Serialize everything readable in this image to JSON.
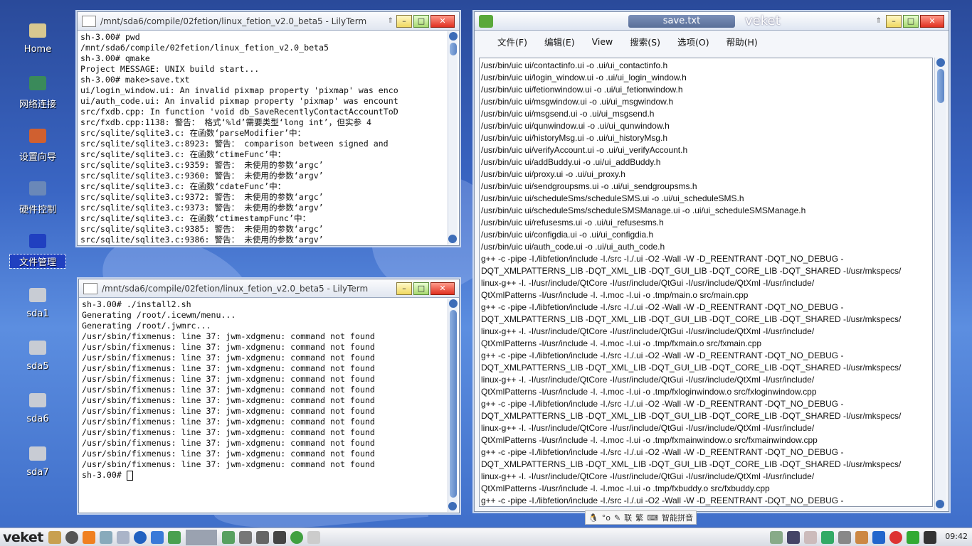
{
  "desktop": {
    "icons": [
      {
        "label": "Home",
        "icon": "folder-icon"
      },
      {
        "label": "网络连接",
        "icon": "network-icon"
      },
      {
        "label": "设置向导",
        "icon": "wizard-icon"
      },
      {
        "label": "硬件控制",
        "icon": "hardware-icon"
      },
      {
        "label": "文件管理",
        "icon": "filemanager-icon"
      },
      {
        "label": "sda1",
        "icon": "drive-icon"
      },
      {
        "label": "sda5",
        "icon": "drive-icon"
      },
      {
        "label": "sda6",
        "icon": "drive-icon"
      },
      {
        "label": "sda7",
        "icon": "drive-icon"
      }
    ]
  },
  "term1": {
    "title": "/mnt/sda6/compile/02fetion/linux_fetion_v2.0_beta5 - LilyTerm",
    "lines": [
      "sh-3.00# pwd",
      "/mnt/sda6/compile/02fetion/linux_fetion_v2.0_beta5",
      "sh-3.00# qmake",
      "Project MESSAGE: UNIX build start...",
      "sh-3.00# make>save.txt",
      "ui/login_window.ui: An invalid pixmap property 'pixmap' was enco",
      "ui/auth_code.ui: An invalid pixmap property 'pixmap' was encount",
      "src/fxdb.cpp: In function 'void db_SaveRecentlyContactAccountToD",
      "src/fxdb.cpp:1138: 警告： 格式‘%ld’需要类型‘long int’，但实参 4",
      "src/sqlite/sqlite3.c: 在函数‘parseModifier’中：",
      "src/sqlite/sqlite3.c:8923: 警告： comparison between signed and",
      "src/sqlite/sqlite3.c: 在函数‘ctimeFunc’中：",
      "src/sqlite/sqlite3.c:9359: 警告： 未使用的参数‘argc’",
      "src/sqlite/sqlite3.c:9360: 警告： 未使用的参数‘argv’",
      "src/sqlite/sqlite3.c: 在函数‘cdateFunc’中：",
      "src/sqlite/sqlite3.c:9372: 警告： 未使用的参数‘argc’",
      "src/sqlite/sqlite3.c:9373: 警告： 未使用的参数‘argv’",
      "src/sqlite/sqlite3.c: 在函数‘ctimestampFunc’中：",
      "src/sqlite/sqlite3.c:9385: 警告： 未使用的参数‘argc’",
      "src/sqlite/sqlite3.c:9386: 警告： 未使用的参数‘argv’"
    ]
  },
  "term2": {
    "title": "/mnt/sda6/compile/02fetion/linux_fetion_v2.0_beta5 - LilyTerm",
    "lines": [
      "sh-3.00# ./install2.sh",
      "Generating /root/.icewm/menu...",
      "Generating /root/.jwmrc...",
      "/usr/sbin/fixmenus: line 37: jwm-xdgmenu: command not found",
      "/usr/sbin/fixmenus: line 37: jwm-xdgmenu: command not found",
      "/usr/sbin/fixmenus: line 37: jwm-xdgmenu: command not found",
      "/usr/sbin/fixmenus: line 37: jwm-xdgmenu: command not found",
      "/usr/sbin/fixmenus: line 37: jwm-xdgmenu: command not found",
      "/usr/sbin/fixmenus: line 37: jwm-xdgmenu: command not found",
      "/usr/sbin/fixmenus: line 37: jwm-xdgmenu: command not found",
      "/usr/sbin/fixmenus: line 37: jwm-xdgmenu: command not found",
      "/usr/sbin/fixmenus: line 37: jwm-xdgmenu: command not found",
      "/usr/sbin/fixmenus: line 37: jwm-xdgmenu: command not found",
      "/usr/sbin/fixmenus: line 37: jwm-xdgmenu: command not found",
      "/usr/sbin/fixmenus: line 37: jwm-xdgmenu: command not found",
      "/usr/sbin/fixmenus: line 37: jwm-xdgmenu: command not found",
      "sh-3.00# "
    ]
  },
  "editor": {
    "title": "save.txt",
    "brand": "veket",
    "menu": [
      "文件(F)",
      "编辑(E)",
      "View",
      "搜索(S)",
      "选项(O)",
      "帮助(H)"
    ],
    "lines": [
      "/usr/bin/uic ui/contactinfo.ui -o .ui/ui_contactinfo.h",
      "/usr/bin/uic ui/login_window.ui -o .ui/ui_login_window.h",
      "/usr/bin/uic ui/fetionwindow.ui -o .ui/ui_fetionwindow.h",
      "/usr/bin/uic ui/msgwindow.ui -o .ui/ui_msgwindow.h",
      "/usr/bin/uic ui/msgsend.ui -o .ui/ui_msgsend.h",
      "/usr/bin/uic ui/qunwindow.ui -o .ui/ui_qunwindow.h",
      "/usr/bin/uic ui/historyMsg.ui -o .ui/ui_historyMsg.h",
      "/usr/bin/uic ui/verifyAccount.ui -o .ui/ui_verifyAccount.h",
      "/usr/bin/uic ui/addBuddy.ui -o .ui/ui_addBuddy.h",
      "/usr/bin/uic ui/proxy.ui -o .ui/ui_proxy.h",
      "/usr/bin/uic ui/sendgroupsms.ui -o .ui/ui_sendgroupsms.h",
      "/usr/bin/uic ui/scheduleSms/scheduleSMS.ui -o .ui/ui_scheduleSMS.h",
      "/usr/bin/uic ui/scheduleSms/scheduleSMSManage.ui -o .ui/ui_scheduleSMSManage.h",
      "/usr/bin/uic ui/refusesms.ui -o .ui/ui_refusesms.h",
      "/usr/bin/uic ui/configdia.ui -o .ui/ui_configdia.h",
      "/usr/bin/uic ui/auth_code.ui -o .ui/ui_auth_code.h",
      "g++ -c -pipe -I./libfetion/include -I./src -I./.ui -O2 -Wall -W -D_REENTRANT -DQT_NO_DEBUG -",
      "DQT_XMLPATTERNS_LIB -DQT_XML_LIB -DQT_GUI_LIB -DQT_CORE_LIB -DQT_SHARED -I/usr/mkspecs/",
      "linux-g++ -I. -I/usr/include/QtCore -I/usr/include/QtGui -I/usr/include/QtXml -I/usr/include/",
      "QtXmlPatterns -I/usr/include -I. -I.moc -I.ui -o .tmp/main.o src/main.cpp",
      "g++ -c -pipe -I./libfetion/include -I./src -I./.ui -O2 -Wall -W -D_REENTRANT -DQT_NO_DEBUG -",
      "DQT_XMLPATTERNS_LIB -DQT_XML_LIB -DQT_GUI_LIB -DQT_CORE_LIB -DQT_SHARED -I/usr/mkspecs/",
      "linux-g++ -I. -I/usr/include/QtCore -I/usr/include/QtGui -I/usr/include/QtXml -I/usr/include/",
      "QtXmlPatterns -I/usr/include -I. -I.moc -I.ui -o .tmp/fxmain.o src/fxmain.cpp",
      "g++ -c -pipe -I./libfetion/include -I./src -I./.ui -O2 -Wall -W -D_REENTRANT -DQT_NO_DEBUG -",
      "DQT_XMLPATTERNS_LIB -DQT_XML_LIB -DQT_GUI_LIB -DQT_CORE_LIB -DQT_SHARED -I/usr/mkspecs/",
      "linux-g++ -I. -I/usr/include/QtCore -I/usr/include/QtGui -I/usr/include/QtXml -I/usr/include/",
      "QtXmlPatterns -I/usr/include -I. -I.moc -I.ui -o .tmp/fxloginwindow.o src/fxloginwindow.cpp",
      "g++ -c -pipe -I./libfetion/include -I./src -I./.ui -O2 -Wall -W -D_REENTRANT -DQT_NO_DEBUG -",
      "DQT_XMLPATTERNS_LIB -DQT_XML_LIB -DQT_GUI_LIB -DQT_CORE_LIB -DQT_SHARED -I/usr/mkspecs/",
      "linux-g++ -I. -I/usr/include/QtCore -I/usr/include/QtGui -I/usr/include/QtXml -I/usr/include/",
      "QtXmlPatterns -I/usr/include -I. -I.moc -I.ui -o .tmp/fxmainwindow.o src/fxmainwindow.cpp",
      "g++ -c -pipe -I./libfetion/include -I./src -I./.ui -O2 -Wall -W -D_REENTRANT -DQT_NO_DEBUG -",
      "DQT_XMLPATTERNS_LIB -DQT_XML_LIB -DQT_GUI_LIB -DQT_CORE_LIB -DQT_SHARED -I/usr/mkspecs/",
      "linux-g++ -I. -I/usr/include/QtCore -I/usr/include/QtGui -I/usr/include/QtXml -I/usr/include/",
      "QtXmlPatterns -I/usr/include -I. -I.moc -I.ui -o .tmp/fxbuddy.o src/fxbuddy.cpp",
      "g++ -c -pipe -I./libfetion/include -I./src -I./.ui -O2 -Wall -W -D_REENTRANT -DQT_NO_DEBUG -"
    ]
  },
  "ime": {
    "items": [
      "联",
      "繁"
    ],
    "mode": "智能拼音"
  },
  "taskbar": {
    "logo": "veket",
    "clock": "09:42"
  }
}
